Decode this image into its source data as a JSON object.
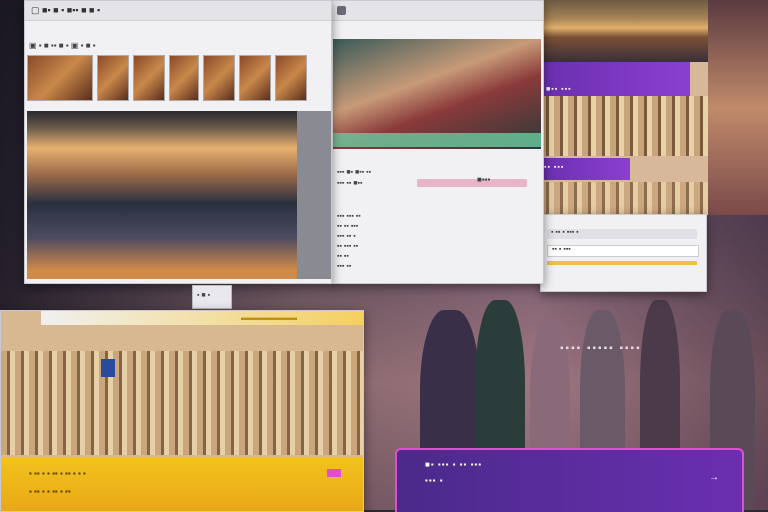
{
  "top_left_window": {
    "title": "▢ ■▪ ■ ▪ ■▪▪ ■ ■ ▪",
    "toolbar": "▣ ▪ ■ ▪▪ ■ ▪ ▣ ▪ ■ ▪",
    "footer": "▪ ■ ▪"
  },
  "center_window": {
    "row1": "▪▪▪ ■▪ ■▪▪ ▪▪",
    "row2": "▪▪▪ ▪▪ ■▪▪",
    "badge": "■▪▪▪",
    "list": [
      "▪▪▪ ▪▪▪ ▪▪",
      "▪▪ ▪▪ ▪▪▪",
      "▪▪▪ ▪▪ ▪",
      "▪▪ ▪▪▪ ▪▪",
      "▪▪ ▪▪",
      "▪▪▪ ▪▪"
    ]
  },
  "right_panel": {
    "purple_label_1": "■▪▪ ▪▪▪",
    "purple_label_2": "▪▪ ▪▪▪"
  },
  "right_window": {
    "row1": "▪ ▪▪ ▪ ▪▪▪ ▪",
    "row2": "▪▪ ▪ ▪▪▪"
  },
  "bottom_left_window": {
    "header": "▬▬▬▬▬▬▬",
    "yellow_line_1": "▪ ▪▪ ▪ ▪ ▪▪ ▪ ▪▪ ▪ ▪ ▪",
    "yellow_line_2": "▪ ▪▪ ▪ ▪ ▪▪ ▪ ▪▪"
  },
  "bottom_right_panel": {
    "line_1": "■▪ ▪▪▪ ▪ ▪▪ ▪▪▪",
    "line_2": "▪▪▪ ▪"
  },
  "floating_caption": "▪▪▪▪ ▪▪▪▪▪ ▪▪▪▪",
  "colors": {
    "accent_purple": "#8b3fd0",
    "accent_yellow": "#f2c31d",
    "accent_pink": "#e04fd0"
  }
}
